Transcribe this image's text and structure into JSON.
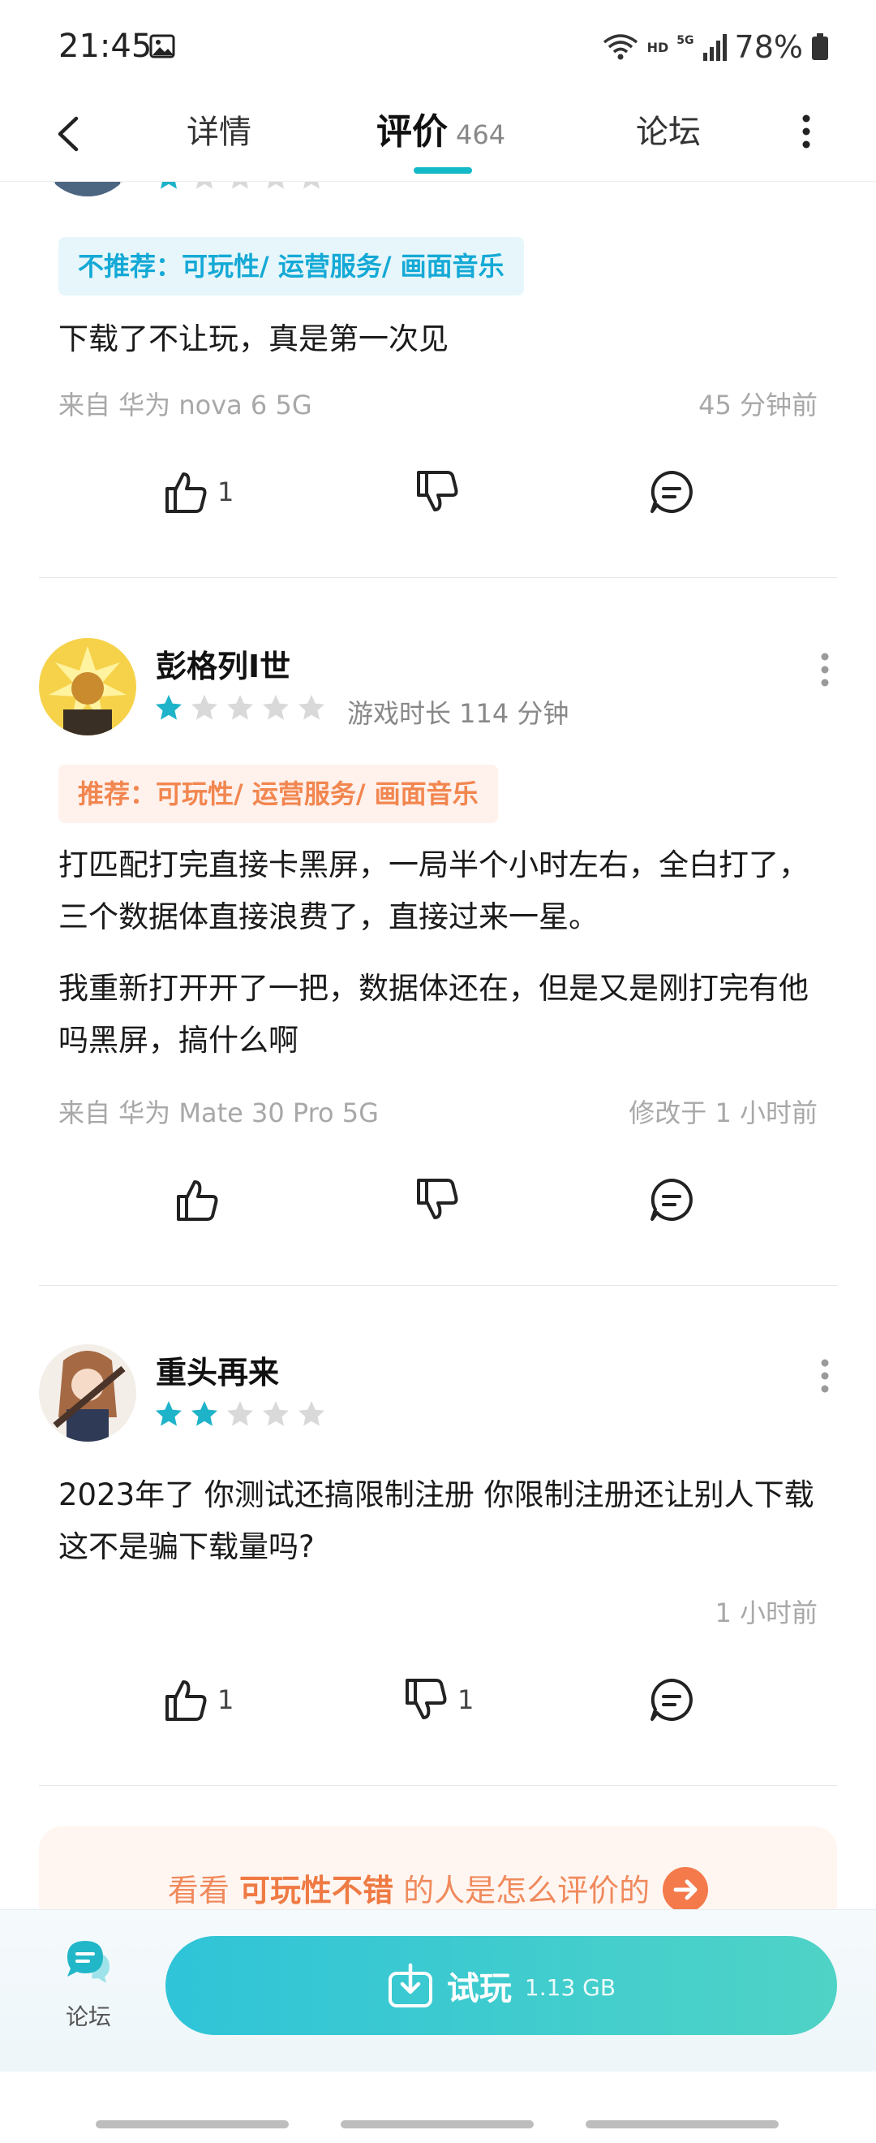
{
  "status_bar": {
    "time": "21:45",
    "hd_label": "HD",
    "net_label": "5G",
    "battery": "78%"
  },
  "header": {
    "tabs": [
      {
        "label": "详情"
      },
      {
        "label": "评价",
        "count": "464"
      },
      {
        "label": "论坛"
      }
    ]
  },
  "reviews": [
    {
      "rating": 1,
      "tag_prefix": "不推荐：",
      "tag_text": "可玩性/ 运营服务/ 画面音乐",
      "tag_type": "negative",
      "paragraphs": [
        "下载了不让玩，真是第一次见"
      ],
      "device": "来自 华为 nova 6 5G",
      "time": "45 分钟前",
      "likes": "1",
      "dislikes": ""
    },
    {
      "username": "彭格列I世",
      "rating": 1,
      "playtime": "游戏时长 114 分钟",
      "tag_prefix": "推荐：",
      "tag_text": "可玩性/ 运营服务/ 画面音乐",
      "tag_type": "positive",
      "paragraphs": [
        "打匹配打完直接卡黑屏，一局半个小时左右，全白打了，三个数据体直接浪费了，直接过来一星。",
        "我重新打开开了一把，数据体还在，但是又是刚打完有他吗黑屏，搞什么啊"
      ],
      "device": "来自 华为 Mate 30 Pro 5G",
      "time": "修改于 1 小时前",
      "likes": "",
      "dislikes": ""
    },
    {
      "username": "重头再来",
      "rating": 2,
      "paragraphs": [
        "2023年了 你测试还搞限制注册 你限制注册还让别人下载 这不是骗下载量吗?"
      ],
      "device": "",
      "time": "1 小时前",
      "likes": "1",
      "dislikes": "1"
    }
  ],
  "promo": {
    "prefix": "看看",
    "highlight": "可玩性不错",
    "suffix": "的人是怎么评价的"
  },
  "bottom_bar": {
    "forum_label": "论坛",
    "try_label": "试玩",
    "size": "1.13 GB"
  },
  "colors": {
    "accent": "#14b9c8",
    "star_on": "#1fb3c9",
    "star_off": "#d9d9d9",
    "negative_tag": "#14a9d6",
    "positive_tag": "#f2864f",
    "promo": "#f47a4b"
  }
}
